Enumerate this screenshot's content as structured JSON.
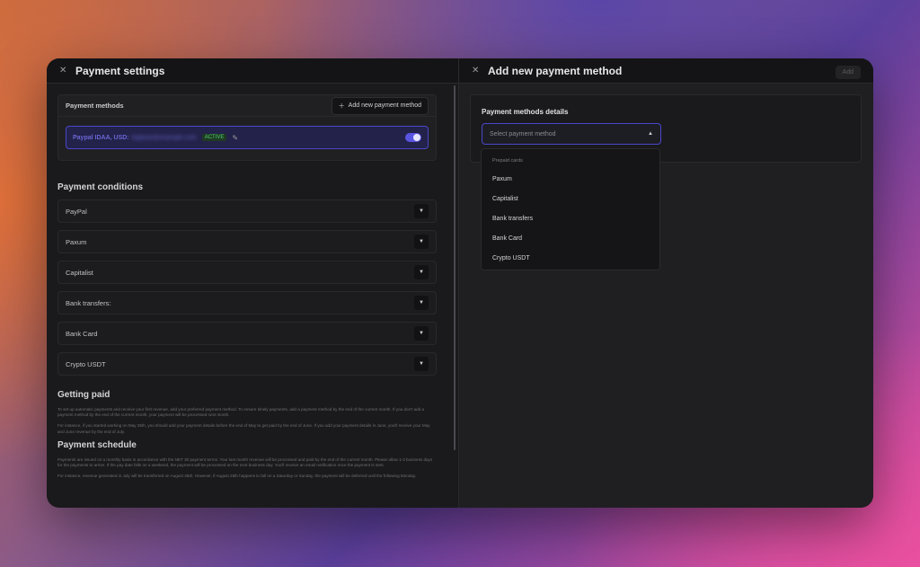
{
  "left": {
    "title": "Payment settings",
    "methods": {
      "title": "Payment methods",
      "add_button": "Add new payment method",
      "items": [
        {
          "name": "Paypal IDAA, USD:",
          "email": "bigbear@example.com",
          "status": "ACTIVE",
          "enabled": true
        }
      ]
    },
    "conditions": {
      "title": "Payment conditions",
      "items": [
        "PayPal",
        "Paxum",
        "Capitalist",
        "Bank transfers:",
        "Bank Card",
        "Crypto USDT"
      ]
    },
    "getting_paid": {
      "title": "Getting paid",
      "p1": "To set up automatic payments and receive your first revenue, add your preferred payment method. To ensure timely payments, add a payment method by the end of the current month. If you don't add a payment method by the end of the current month, your payment will be processed next month.",
      "p2": "For instance, if you started working on May 25th, you should add your payment details before the end of May to get paid by the end of June. If you add your payment details in June, you'll receive your May and June revenue by the end of July."
    },
    "schedule": {
      "title": "Payment schedule",
      "p1": "Payments are issued on a monthly basis in accordance with the NET 30 payment terms. Your last month revenue will be processed and paid by the end of the current month. Please allow 1-3 business days for the payments to arrive. If the pay date falls on a weekend, the payment will be processed on the next business day. You'll receive an email notification once the payment is sent.",
      "p2": "For instance, revenue generated in July will be transferred on August 25th. However, if August 25th happens to fall on a Saturday or Sunday, the payment will be deferred until the following Monday."
    }
  },
  "right": {
    "title": "Add new payment method",
    "add_button": "Add",
    "details_title": "Payment methods details",
    "select_placeholder": "Select payment method",
    "dropdown": {
      "group": "Prepaid cards",
      "options": [
        "Paxum",
        "Capitalist",
        "Bank transfers",
        "Bank Card",
        "Crypto USDT"
      ]
    }
  },
  "icons": {
    "close": "close-icon",
    "plus": "plus-icon",
    "pencil": "pencil-icon",
    "chevron": "chevron-down-icon",
    "caret_up": "caret-up-icon"
  },
  "colors": {
    "accent": "#4b47c9",
    "active_badge_text": "#4bcf6b"
  }
}
